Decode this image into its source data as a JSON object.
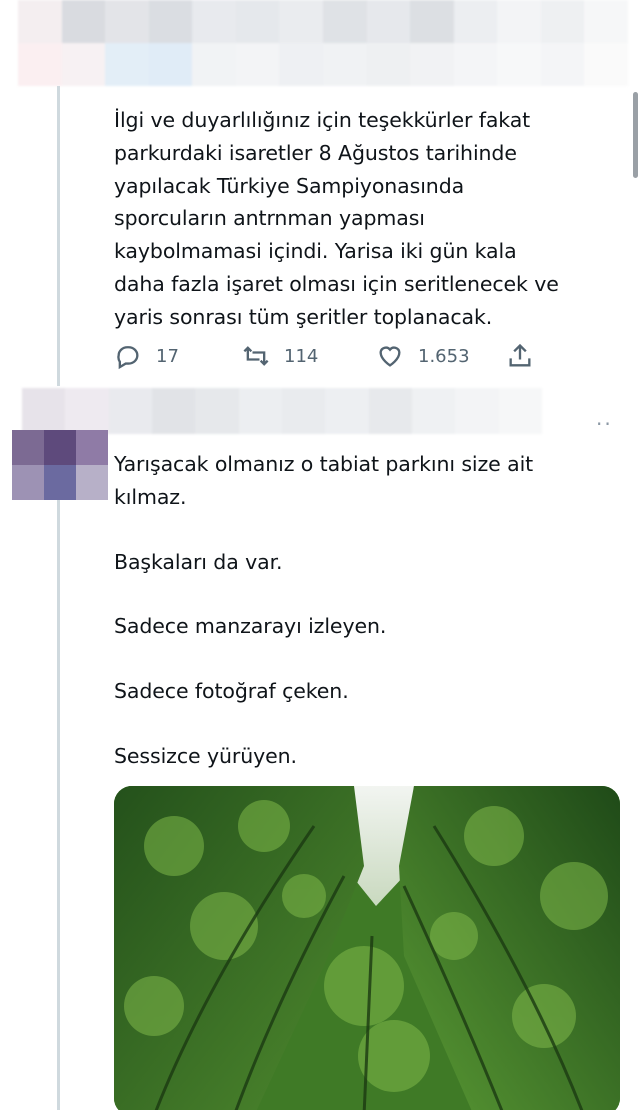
{
  "reply_tweet": {
    "text": "İlgi ve duyarlılığınız için teşekkürler fakat\nparkurdaki isaretler 8 Ağustos tarihinde\nyapılacak Türkiye Sampiyonasında\nsporcuların antrnman yapması\nkaybolmamasi içindi. Yarisa iki gün kala\ndaha fazla işaret olması için seritlenecek ve\nyaris sonrası tüm şeritler toplanacak.",
    "reply_count": "17",
    "retweet_count": "114",
    "like_count": "1.653"
  },
  "second_tweet": {
    "paragraphs": [
      "Yarışacak olmanız o tabiat parkını size ait\nkılmaz.",
      "Başkaları da var.",
      "Sadece manzarayı izleyen.",
      "Sadece fotoğraf çeken.",
      "Sessizce yürüyen."
    ],
    "more_label": "··",
    "media_icon": "forest-photo"
  },
  "icons": {
    "reply": "reply-icon",
    "retweet": "retweet-icon",
    "like": "heart-icon",
    "share": "share-icon"
  },
  "colors": {
    "text": "#0f1419",
    "secondary": "#536471",
    "thread_line": "#cfd9de"
  }
}
